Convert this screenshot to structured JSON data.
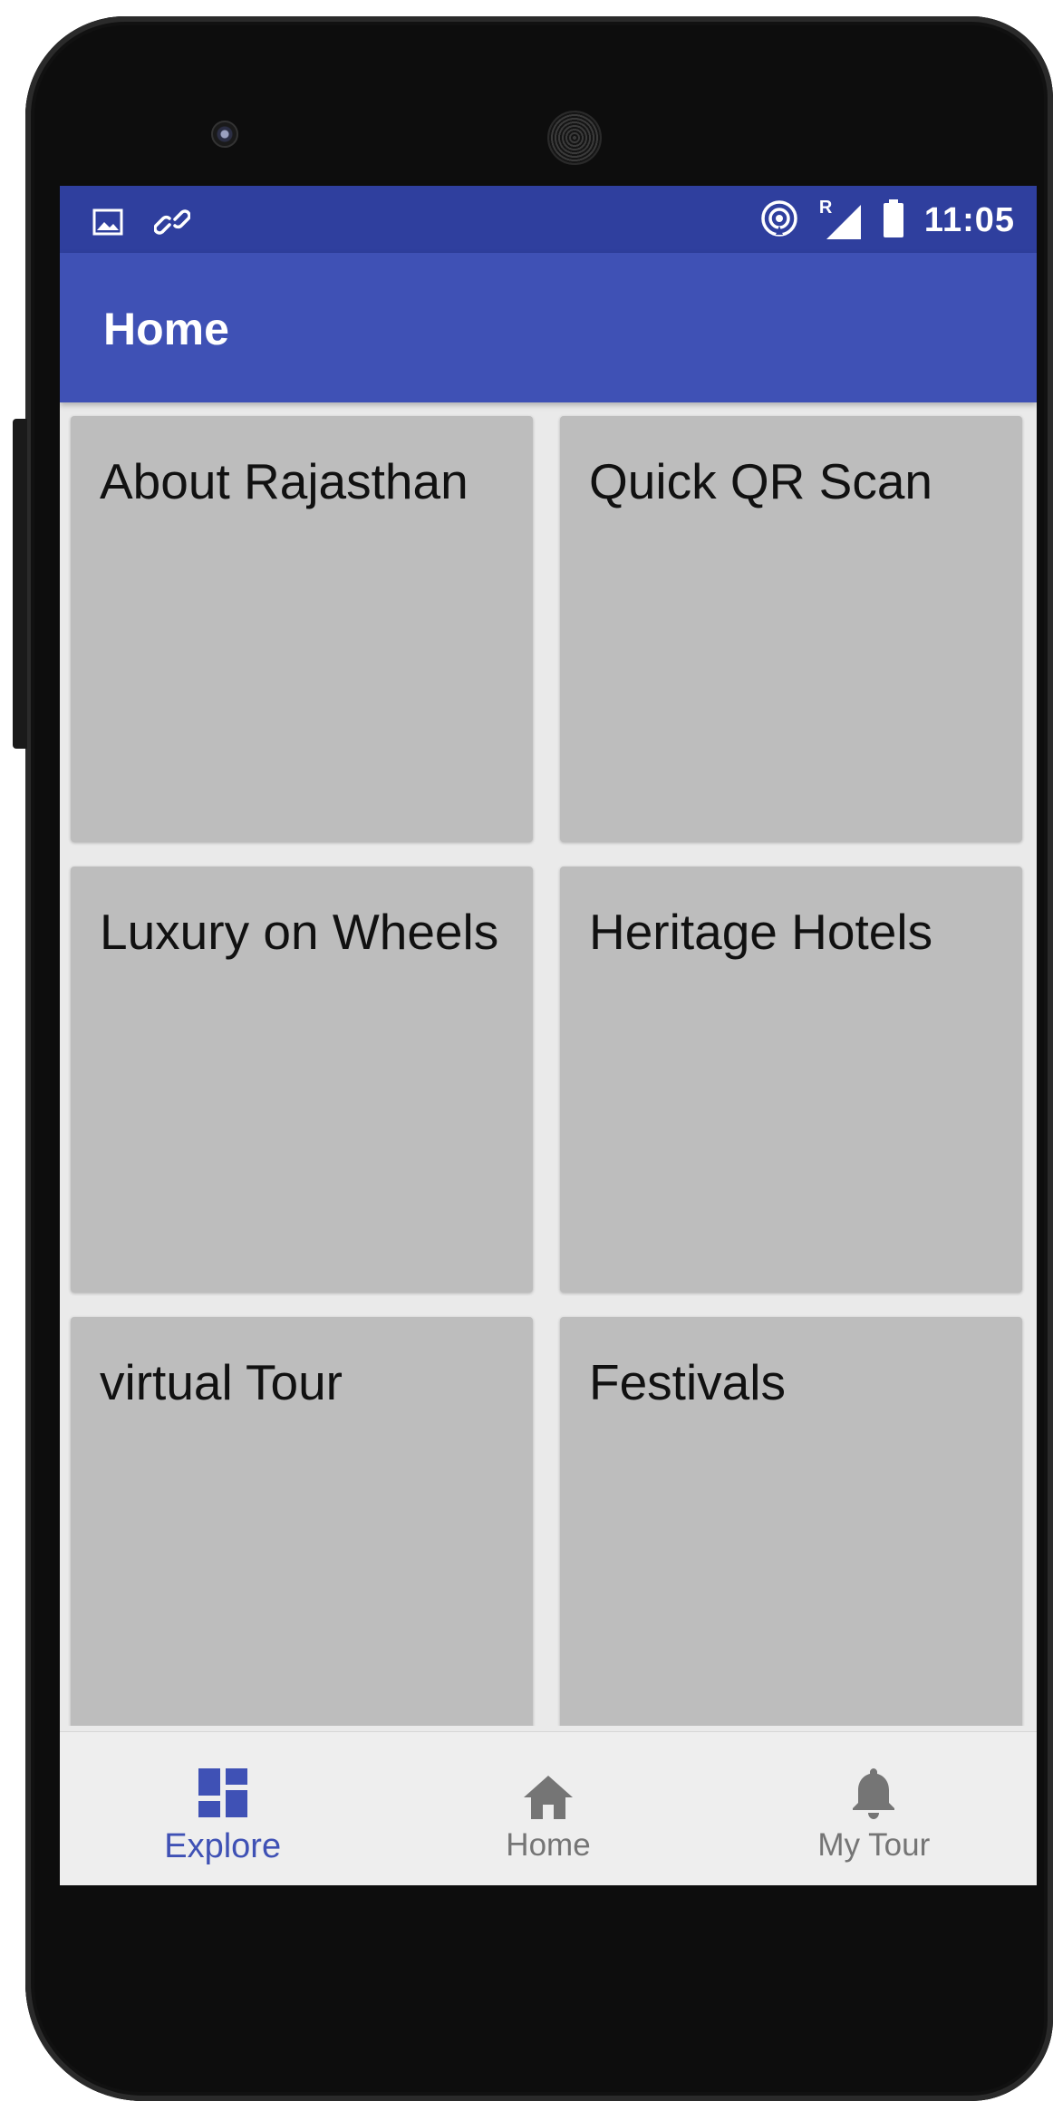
{
  "status_bar": {
    "time": "11:05",
    "left_icons": [
      "image-icon",
      "link-icon"
    ],
    "right_icons": [
      "hotspot-icon",
      "signal-icon",
      "battery-icon"
    ],
    "roaming_indicator": "R"
  },
  "app_bar": {
    "title": "Home",
    "color": "#3f51b5",
    "status_color": "#2f3f9e"
  },
  "tiles": [
    {
      "label": "About Rajasthan"
    },
    {
      "label": "Quick QR Scan"
    },
    {
      "label": "Luxury on Wheels"
    },
    {
      "label": "Heritage Hotels"
    },
    {
      "label": "virtual Tour"
    },
    {
      "label": "Festivals"
    }
  ],
  "bottom_nav": {
    "items": [
      {
        "label": "Explore",
        "icon": "dashboard-icon",
        "active": true
      },
      {
        "label": "Home",
        "icon": "home-icon",
        "active": false
      },
      {
        "label": "My Tour",
        "icon": "bell-icon",
        "active": false
      }
    ],
    "active_color": "#3f51b5",
    "inactive_color": "#757575"
  }
}
